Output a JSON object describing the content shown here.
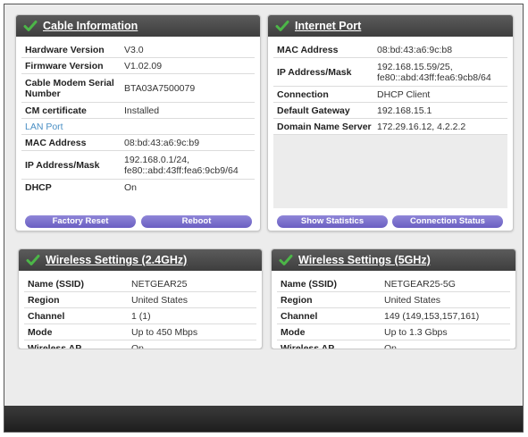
{
  "cable": {
    "title": "Cable Information",
    "rows": [
      {
        "label": "Hardware Version",
        "value": "V3.0"
      },
      {
        "label": "Firmware Version",
        "value": "V1.02.09"
      },
      {
        "label": "Cable Modem Serial Number",
        "value": "BTA03A7500079"
      },
      {
        "label": "CM certificate",
        "value": "Installed"
      },
      {
        "label": "LAN Port",
        "value": ""
      },
      {
        "label": "MAC Address",
        "value": "08:bd:43:a6:9c:b9"
      },
      {
        "label": "IP Address/Mask",
        "value": "192.168.0.1/24,\nfe80::abd:43ff:fea6:9cb9/64"
      },
      {
        "label": "DHCP",
        "value": "On"
      }
    ],
    "buttons": {
      "factory_reset": "Factory Reset",
      "reboot": "Reboot"
    }
  },
  "internet": {
    "title": "Internet Port",
    "rows": [
      {
        "label": "MAC Address",
        "value": "08:bd:43:a6:9c:b8"
      },
      {
        "label": "IP Address/Mask",
        "value": "192.168.15.59/25,\nfe80::abd:43ff:fea6:9cb8/64"
      },
      {
        "label": "Connection",
        "value": "DHCP Client"
      },
      {
        "label": "Default Gateway",
        "value": "192.168.15.1"
      },
      {
        "label": "Domain Name Server",
        "value": "172.29.16.12, 4.2.2.2"
      }
    ],
    "buttons": {
      "show_statistics": "Show Statistics",
      "connection_status": "Connection Status"
    }
  },
  "wireless24": {
    "title": "Wireless Settings (2.4GHz)",
    "rows": [
      {
        "label": "Name (SSID)",
        "value": "NETGEAR25"
      },
      {
        "label": "Region",
        "value": "United States"
      },
      {
        "label": "Channel",
        "value": "1 (1)"
      },
      {
        "label": "Mode",
        "value": "Up to 450 Mbps"
      },
      {
        "label": "Wireless AP",
        "value": "On"
      }
    ]
  },
  "wireless5": {
    "title": "Wireless Settings (5GHz)",
    "rows": [
      {
        "label": "Name (SSID)",
        "value": "NETGEAR25-5G"
      },
      {
        "label": "Region",
        "value": "United States"
      },
      {
        "label": "Channel",
        "value": "149 (149,153,157,161)"
      },
      {
        "label": "Mode",
        "value": "Up to 1.3 Gbps"
      },
      {
        "label": "Wireless AP",
        "value": "On"
      }
    ]
  },
  "colors": {
    "header": "#4a4a4a",
    "button": "#7b71cf",
    "check": "#4cb648",
    "section_label": "#4a8fc4"
  },
  "icons": {
    "panel_status": "check-icon"
  }
}
